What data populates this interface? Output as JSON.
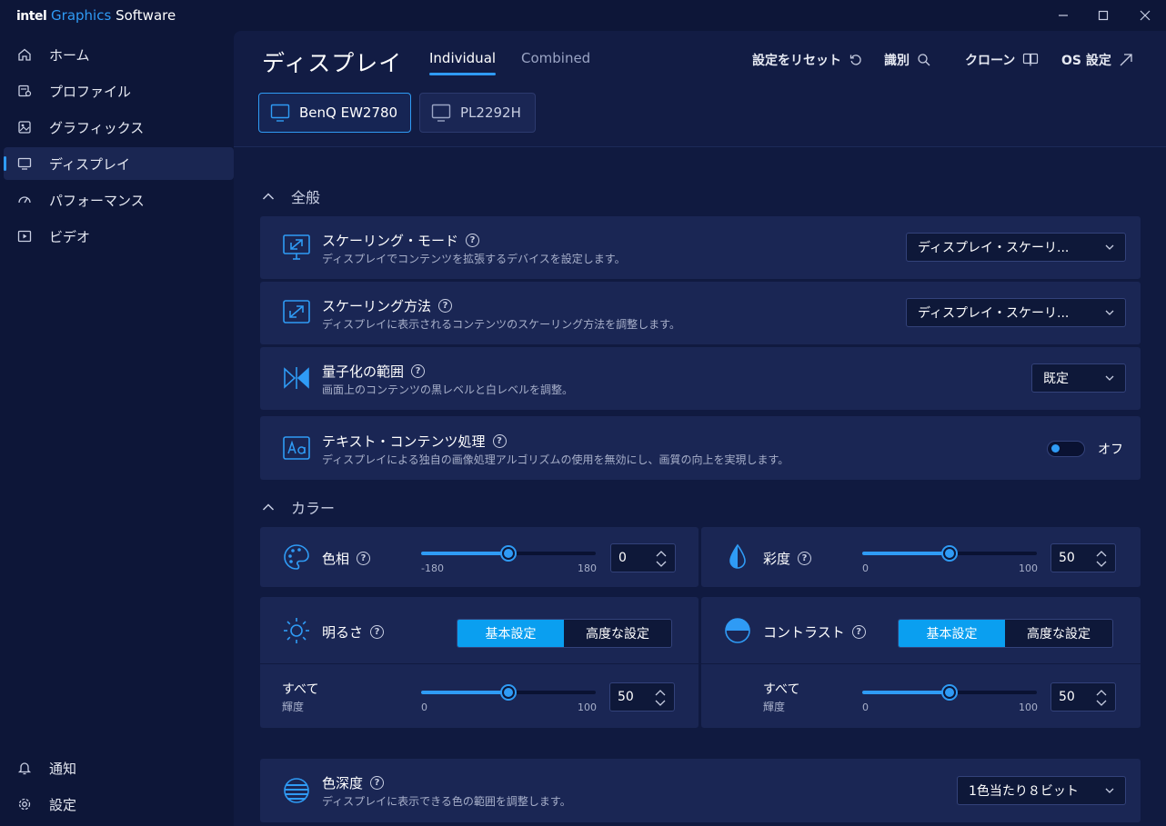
{
  "app": {
    "brand_intel": "intel",
    "brand_graphics": "Graphics",
    "brand_software": "Software"
  },
  "colors": {
    "accent": "#2f9bf5",
    "sidebar_bg": "#0d1638",
    "card_bg": "#1a2654",
    "segment_active": "#0a9ff0"
  },
  "sidebar": {
    "items": [
      {
        "label": "ホーム",
        "icon": "home-icon"
      },
      {
        "label": "プロファイル",
        "icon": "profile-icon"
      },
      {
        "label": "グラフィックス",
        "icon": "graphics-icon"
      },
      {
        "label": "ディスプレイ",
        "icon": "display-icon",
        "active": true
      },
      {
        "label": "パフォーマンス",
        "icon": "performance-icon"
      },
      {
        "label": "ビデオ",
        "icon": "video-icon"
      }
    ],
    "bottom": [
      {
        "label": "通知",
        "icon": "bell-icon"
      },
      {
        "label": "設定",
        "icon": "gear-icon"
      }
    ]
  },
  "header": {
    "title": "ディスプレイ",
    "tabs": [
      {
        "label": "Individual",
        "active": true
      },
      {
        "label": "Combined"
      }
    ],
    "actions": {
      "reset": "設定をリセット",
      "identify": "識別",
      "clone": "クローン",
      "os": "OS 設定"
    },
    "displays": [
      {
        "label": "BenQ EW2780",
        "active": true
      },
      {
        "label": "PL2292H"
      }
    ]
  },
  "general": {
    "heading": "全般",
    "scaling_mode": {
      "title": "スケーリング・モード",
      "desc": "ディスプレイでコンテンツを拡張するデバイスを設定します。",
      "value": "ディスプレイ・スケーリ..."
    },
    "scaling_method": {
      "title": "スケーリング方法",
      "desc": "ディスプレイに表示されるコンテンツのスケーリング方法を調整します。",
      "value": "ディスプレイ・スケーリ..."
    },
    "quantization": {
      "title": "量子化の範囲",
      "desc": "画面上のコンテンツの黒レベルと白レベルを調整。",
      "value": "既定"
    },
    "text_processing": {
      "title": "テキスト・コンテンツ処理",
      "desc": "ディスプレイによる独自の画像処理アルゴリズムの使用を無効にし、画質の向上を実現します。",
      "value": "オフ"
    }
  },
  "color": {
    "heading": "カラー",
    "hue": {
      "title": "色相",
      "min": "-180",
      "max": "180",
      "value": "0",
      "fraction": 0.5
    },
    "saturation": {
      "title": "彩度",
      "min": "0",
      "max": "100",
      "value": "50",
      "fraction": 0.5
    },
    "brightness": {
      "title": "明るさ",
      "seg_basic": "基本設定",
      "seg_advanced": "高度な設定",
      "channel": "すべて",
      "sub": "輝度",
      "min": "0",
      "max": "100",
      "value": "50",
      "fraction": 0.5
    },
    "contrast": {
      "title": "コントラスト",
      "seg_basic": "基本設定",
      "seg_advanced": "高度な設定",
      "channel": "すべて",
      "sub": "輝度",
      "min": "0",
      "max": "100",
      "value": "50",
      "fraction": 0.5
    },
    "depth": {
      "title": "色深度",
      "desc": "ディスプレイに表示できる色の範囲を調整します。",
      "value": "1色当たり８ビット"
    }
  }
}
